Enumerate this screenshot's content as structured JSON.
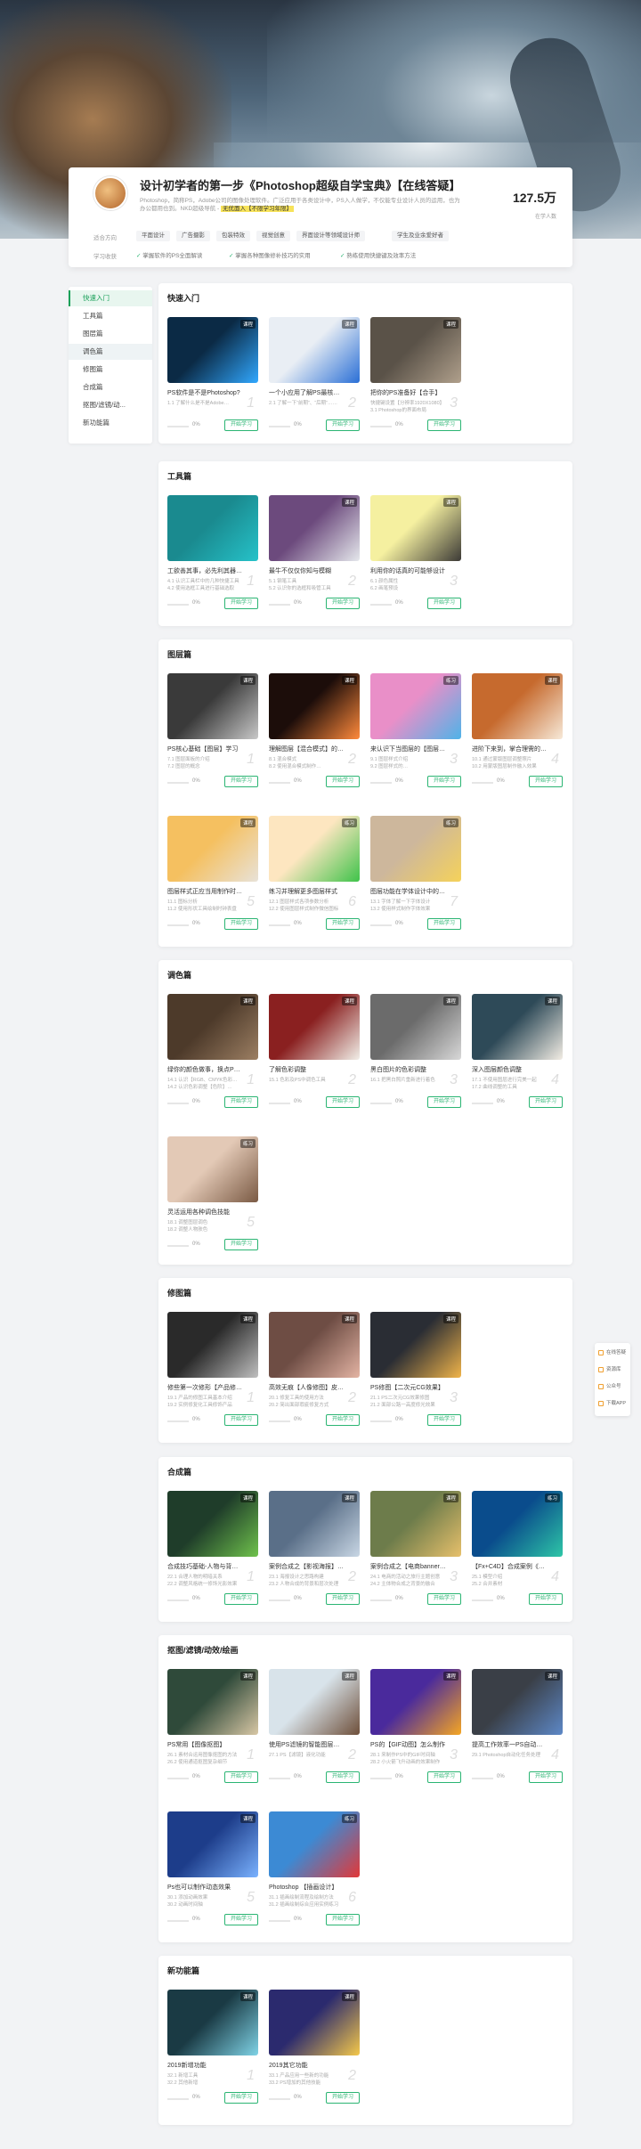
{
  "course": {
    "title": "设计初学者的第一步《Photoshop超级自学宝典》【在线答疑】",
    "desc": "Photoshop，简称PS，Adobe公司的图像处理软件。广泛应用于各类设计中，PS入人做学，不仅能专业设计人员的运用，也为办公都用也到。NKD超级导航 -",
    "desc_hl": "无优面入【不限学习年限】",
    "stat_num": "127.5万",
    "stat_label": "在学人数",
    "row1_label": "适合方向",
    "row2_label": "学习收获",
    "tags": [
      "平面设计",
      "广告摄影",
      "包装特效",
      "视觉创意",
      "界面设计等领域设计师",
      "学生及业余爱好者"
    ],
    "checks": [
      "掌握软件的PS全面解读",
      "掌握各种图像修补技巧的实用",
      "熟练使用快捷键及效率方法"
    ]
  },
  "sidebar": {
    "items": [
      "快速入门",
      "工具篇",
      "图层篇",
      "调色篇",
      "修图篇",
      "合成篇",
      "抠图/滤镜/动...",
      "新功能篇"
    ]
  },
  "sections": [
    {
      "title": "快速入门",
      "items": [
        {
          "t": "PS软件是不是Photoshop?",
          "s1": "1.1 了解什么是不是Adobe…",
          "s2": "",
          "n": "1",
          "badge": "课程",
          "color": "#0b2a45",
          "accent": "#31a8ff"
        },
        {
          "t": "一个小应用了解PS最核心概念",
          "s1": "2.1 了解一下“前期”、“后期”……",
          "s2": "",
          "n": "2",
          "badge": "课程",
          "color": "#e9eef4",
          "accent": "#2a6fd6"
        },
        {
          "t": "把你的PS准备好【合手】",
          "s1": "快捷键设置【分辨率1920X1080】",
          "s2": "3.1 Photoshop的界面布局",
          "n": "3",
          "badge": "课程",
          "color": "#5a5248",
          "accent": "#b0a08c"
        }
      ]
    },
    {
      "title": "工具篇",
      "items": [
        {
          "t": "工欲善其事，必先利其器，掌…",
          "s1": "4.1 认识工具栏中的几种快捷工具",
          "s2": "4.2 使用选框工具进行基础选取",
          "n": "1",
          "badge": "",
          "color": "#1a8a8f",
          "accent": "#26c2c9"
        },
        {
          "t": "最牛不仅仅你知与模糊",
          "s1": "5.1 钢笔工具",
          "s2": "5.2 认识你的选框和吸管工具",
          "n": "2",
          "badge": "课程",
          "color": "#6c4a7d",
          "accent": "#e5e8ec"
        },
        {
          "t": "利用你的话真的可能够设计",
          "s1": "6.1 颜色属性",
          "s2": "6.2 画笔预设",
          "n": "3",
          "badge": "课程",
          "color": "#f5f0a0",
          "accent": "#3c3a36"
        }
      ]
    },
    {
      "title": "图层篇",
      "items": [
        {
          "t": "PS核心基础【图层】学习",
          "s1": "7.1 图层面板的介绍",
          "s2": "7.2 图层的概念",
          "n": "1",
          "badge": "课程",
          "color": "#3a3a3a",
          "accent": "#c8c8c8"
        },
        {
          "t": "理解图层【混合模式】的效果",
          "s1": "8.1 混合模式",
          "s2": "8.2 使用混合模式制作…",
          "n": "2",
          "badge": "课程",
          "color": "#1c0d0a",
          "accent": "#ff8a3c"
        },
        {
          "t": "来认识下当图层的【图层样式】",
          "s1": "9.1 图层样式介绍",
          "s2": "9.2 图层样式的…",
          "n": "3",
          "badge": "练习",
          "color": "#e98fc8",
          "accent": "#4fb3e8"
        },
        {
          "t": "进阶下来到，掌合理需的【图…",
          "s1": "10.1 通过蒙版图层调整照片",
          "s2": "10.2 用蒙版图层制作融入效果",
          "n": "4",
          "badge": "课程",
          "color": "#c66a2e",
          "accent": "#f7e9d8"
        },
        {
          "t": "图层样式正应当用制作时钟图标",
          "s1": "11.1 图标分析",
          "s2": "11.2 使用形状工具绘制时钟表盘",
          "n": "5",
          "badge": "课程",
          "color": "#f5c060",
          "accent": "#e8e2d8"
        },
        {
          "t": "练习并理解更多图层样式",
          "s1": "12.1 图层样式各项参数分析",
          "s2": "12.2 使用图层样式制作微信图标",
          "n": "6",
          "badge": "练习",
          "color": "#fde6c0",
          "accent": "#3fc34a"
        },
        {
          "t": "图层功能在学体设计中的应用…",
          "s1": "13.1 字体了解一下字体设计",
          "s2": "13.2 使用样式制作字体效果",
          "n": "7",
          "badge": "练习",
          "color": "#cdb79c",
          "accent": "#f5d25a"
        }
      ]
    },
    {
      "title": "调色篇",
      "items": [
        {
          "t": "绿你的颜色做事，换点PS调色…",
          "s1": "14.1 认识【RGB、CMYK色彩…",
          "s2": "14.2 认识色彩调整【色阶】…",
          "n": "1",
          "badge": "课程",
          "color": "#4d3a2a",
          "accent": "#9c7f63"
        },
        {
          "t": "了解色彩调整",
          "s1": "15.1 色彩及PS中调色工具",
          "s2": "",
          "n": "2",
          "badge": "课程",
          "color": "#8a2020",
          "accent": "#f1efe8"
        },
        {
          "t": "黑白图片的色彩调整",
          "s1": "16.1 把黑白照片重新进行着色",
          "s2": "",
          "n": "3",
          "badge": "课程",
          "color": "#6b6b6b",
          "accent": "#d8d8d8"
        },
        {
          "t": "深入图层颜色调整",
          "s1": "17.1 不使用图层进行完美一起",
          "s2": "17.2 曲线调整的工具",
          "n": "4",
          "badge": "课程",
          "color": "#2e4a58",
          "accent": "#f2ede4"
        },
        {
          "t": "灵活运用各种调色技能",
          "s1": "18.1 调整图层调色",
          "s2": "18.2 调整人物肤色",
          "n": "5",
          "badge": "练习",
          "color": "#e3c9b6",
          "accent": "#7a5a44"
        }
      ]
    },
    {
      "title": "修图篇",
      "items": [
        {
          "t": "修些第一次修形【产品修图】",
          "s1": "19.1 产品的修图工具基本介绍",
          "s2": "19.2 实例修复化工具修饰产品",
          "n": "1",
          "badge": "课程",
          "color": "#2a2a2a",
          "accent": "#bfbfbf"
        },
        {
          "t": "高效无痕【人像修图】皮肤美…",
          "s1": "20.1 修复工具的使用方法",
          "s2": "20.2 简出面部瑕疵修复方式",
          "n": "2",
          "badge": "课程",
          "color": "#6e4d44",
          "accent": "#e3b3a3"
        },
        {
          "t": "PS修图【二次元CG效果】",
          "s1": "21.1 PS二次元CG效果修图",
          "s2": "21.2 面部公路一高度修光效果",
          "n": "3",
          "badge": "课程",
          "color": "#2a2d34",
          "accent": "#f0b44a"
        }
      ]
    },
    {
      "title": "合成篇",
      "items": [
        {
          "t": "合成技巧基础-人物与背景融…",
          "s1": "22.1 合理人物的明暗关系",
          "s2": "22.2 调整风格统一修饰光影效果",
          "n": "1",
          "badge": "课程",
          "color": "#1f3d2a",
          "accent": "#6fc24c"
        },
        {
          "t": "案例合成之【影视海报】绿色…",
          "s1": "23.1 海报设计之思路构建",
          "s2": "23.2 人物合成的背景和层次处理",
          "n": "2",
          "badge": "课程",
          "color": "#5a6f88",
          "accent": "#c8d6e4"
        },
        {
          "t": "案例合成之【电商banner】…",
          "s1": "24.1 电商的活动之旅行主题创意",
          "s2": "24.2 主体物合成之背景的融合",
          "n": "3",
          "badge": "课程",
          "color": "#6d7c4b",
          "accent": "#e7c06b"
        },
        {
          "t": "【Fx+C4D】合成案例《后火…",
          "s1": "25.1 模型介绍",
          "s2": "25.2 合并素材",
          "n": "4",
          "badge": "练习",
          "color": "#0a4c8c",
          "accent": "#2ec6a7"
        }
      ]
    },
    {
      "title": "抠图/滤镜/动效/绘画",
      "items": [
        {
          "t": "PS常用【图像抠图】",
          "s1": "26.1 素材合运用图像抠图的方法",
          "s2": "26.2 使用通道抠图复杂细节",
          "n": "1",
          "badge": "课程",
          "color": "#2f4a3a",
          "accent": "#d8c7a5"
        },
        {
          "t": "使用PS滤镜的智能图层方法",
          "s1": "27.1 PS【滤镜】液化功能",
          "s2": "",
          "n": "2",
          "badge": "课程",
          "color": "#d8e3ea",
          "accent": "#6e4f3a"
        },
        {
          "t": "PS的【GIF动图】怎么制作",
          "s1": "28.1 来制作PS中的GIF时间轴",
          "s2": "28.2 小火箭飞升动画的效果制作",
          "n": "3",
          "badge": "课程",
          "color": "#4a2a9c",
          "accent": "#f5a623"
        },
        {
          "t": "提高工作效率一PS自动化任务",
          "s1": "29.1 Photoshop自动化任务处理",
          "s2": "",
          "n": "4",
          "badge": "课程",
          "color": "#3a3f47",
          "accent": "#5d88c7"
        },
        {
          "t": "Ps也可以制作动态效果",
          "s1": "30.1 添加动画效果",
          "s2": "30.2 动画时间轴",
          "n": "5",
          "badge": "课程",
          "color": "#1d3d8a",
          "accent": "#7ab2ff"
        },
        {
          "t": "Photoshop 【插画设计】",
          "s1": "31.1 插画绘制流程及绘制方法",
          "s2": "31.2 插画绘制综合应用实例练习",
          "n": "6",
          "badge": "练习",
          "color": "#3c8ad4",
          "accent": "#e23838"
        }
      ]
    },
    {
      "title": "新功能篇",
      "items": [
        {
          "t": "2019新增功能",
          "s1": "32.1 新增工具",
          "s2": "32.2 其他新增",
          "n": "1",
          "badge": "课程",
          "color": "#1a3a44",
          "accent": "#7fd3e6"
        },
        {
          "t": "2019其它功能",
          "s1": "33.1 产品应用一些新的功能",
          "s2": "33.2 PS增加的其他技能",
          "n": "2",
          "badge": "课程",
          "color": "#2b2a6e",
          "accent": "#f4c84a"
        }
      ]
    }
  ],
  "common": {
    "pct": "0%",
    "btn": "开始学习"
  },
  "float_bar": [
    "在线答疑",
    "资源库",
    "公众号",
    "下载APP"
  ]
}
